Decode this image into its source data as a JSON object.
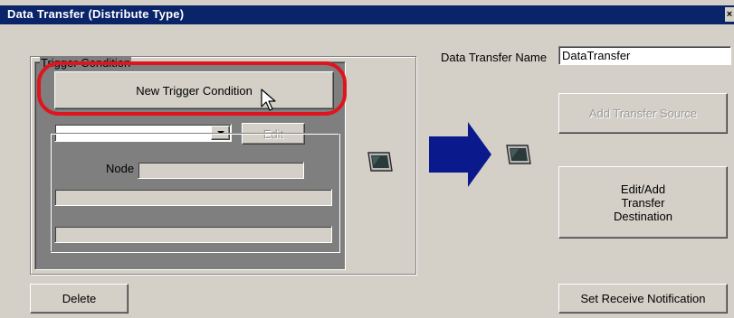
{
  "window": {
    "title": "Data Transfer (Distribute Type)",
    "close_glyph": "×"
  },
  "trigger": {
    "group_label": "Trigger Condition",
    "new_button": "New Trigger Condition",
    "edit_button": "Edit",
    "node_label": "Node",
    "combo_value": "",
    "node_value": ""
  },
  "name_field": {
    "label": "Data Transfer Name",
    "value": "DataTransfer"
  },
  "buttons": {
    "add_source": "Add Transfer Source",
    "edit_destination": "Edit/Add Transfer Destination",
    "delete": "Delete",
    "receive_notification": "Set Receive Notification"
  },
  "colors": {
    "highlight": "#e0141e",
    "arrow": "#0a1a8c",
    "title_bar": "#0a246a"
  }
}
